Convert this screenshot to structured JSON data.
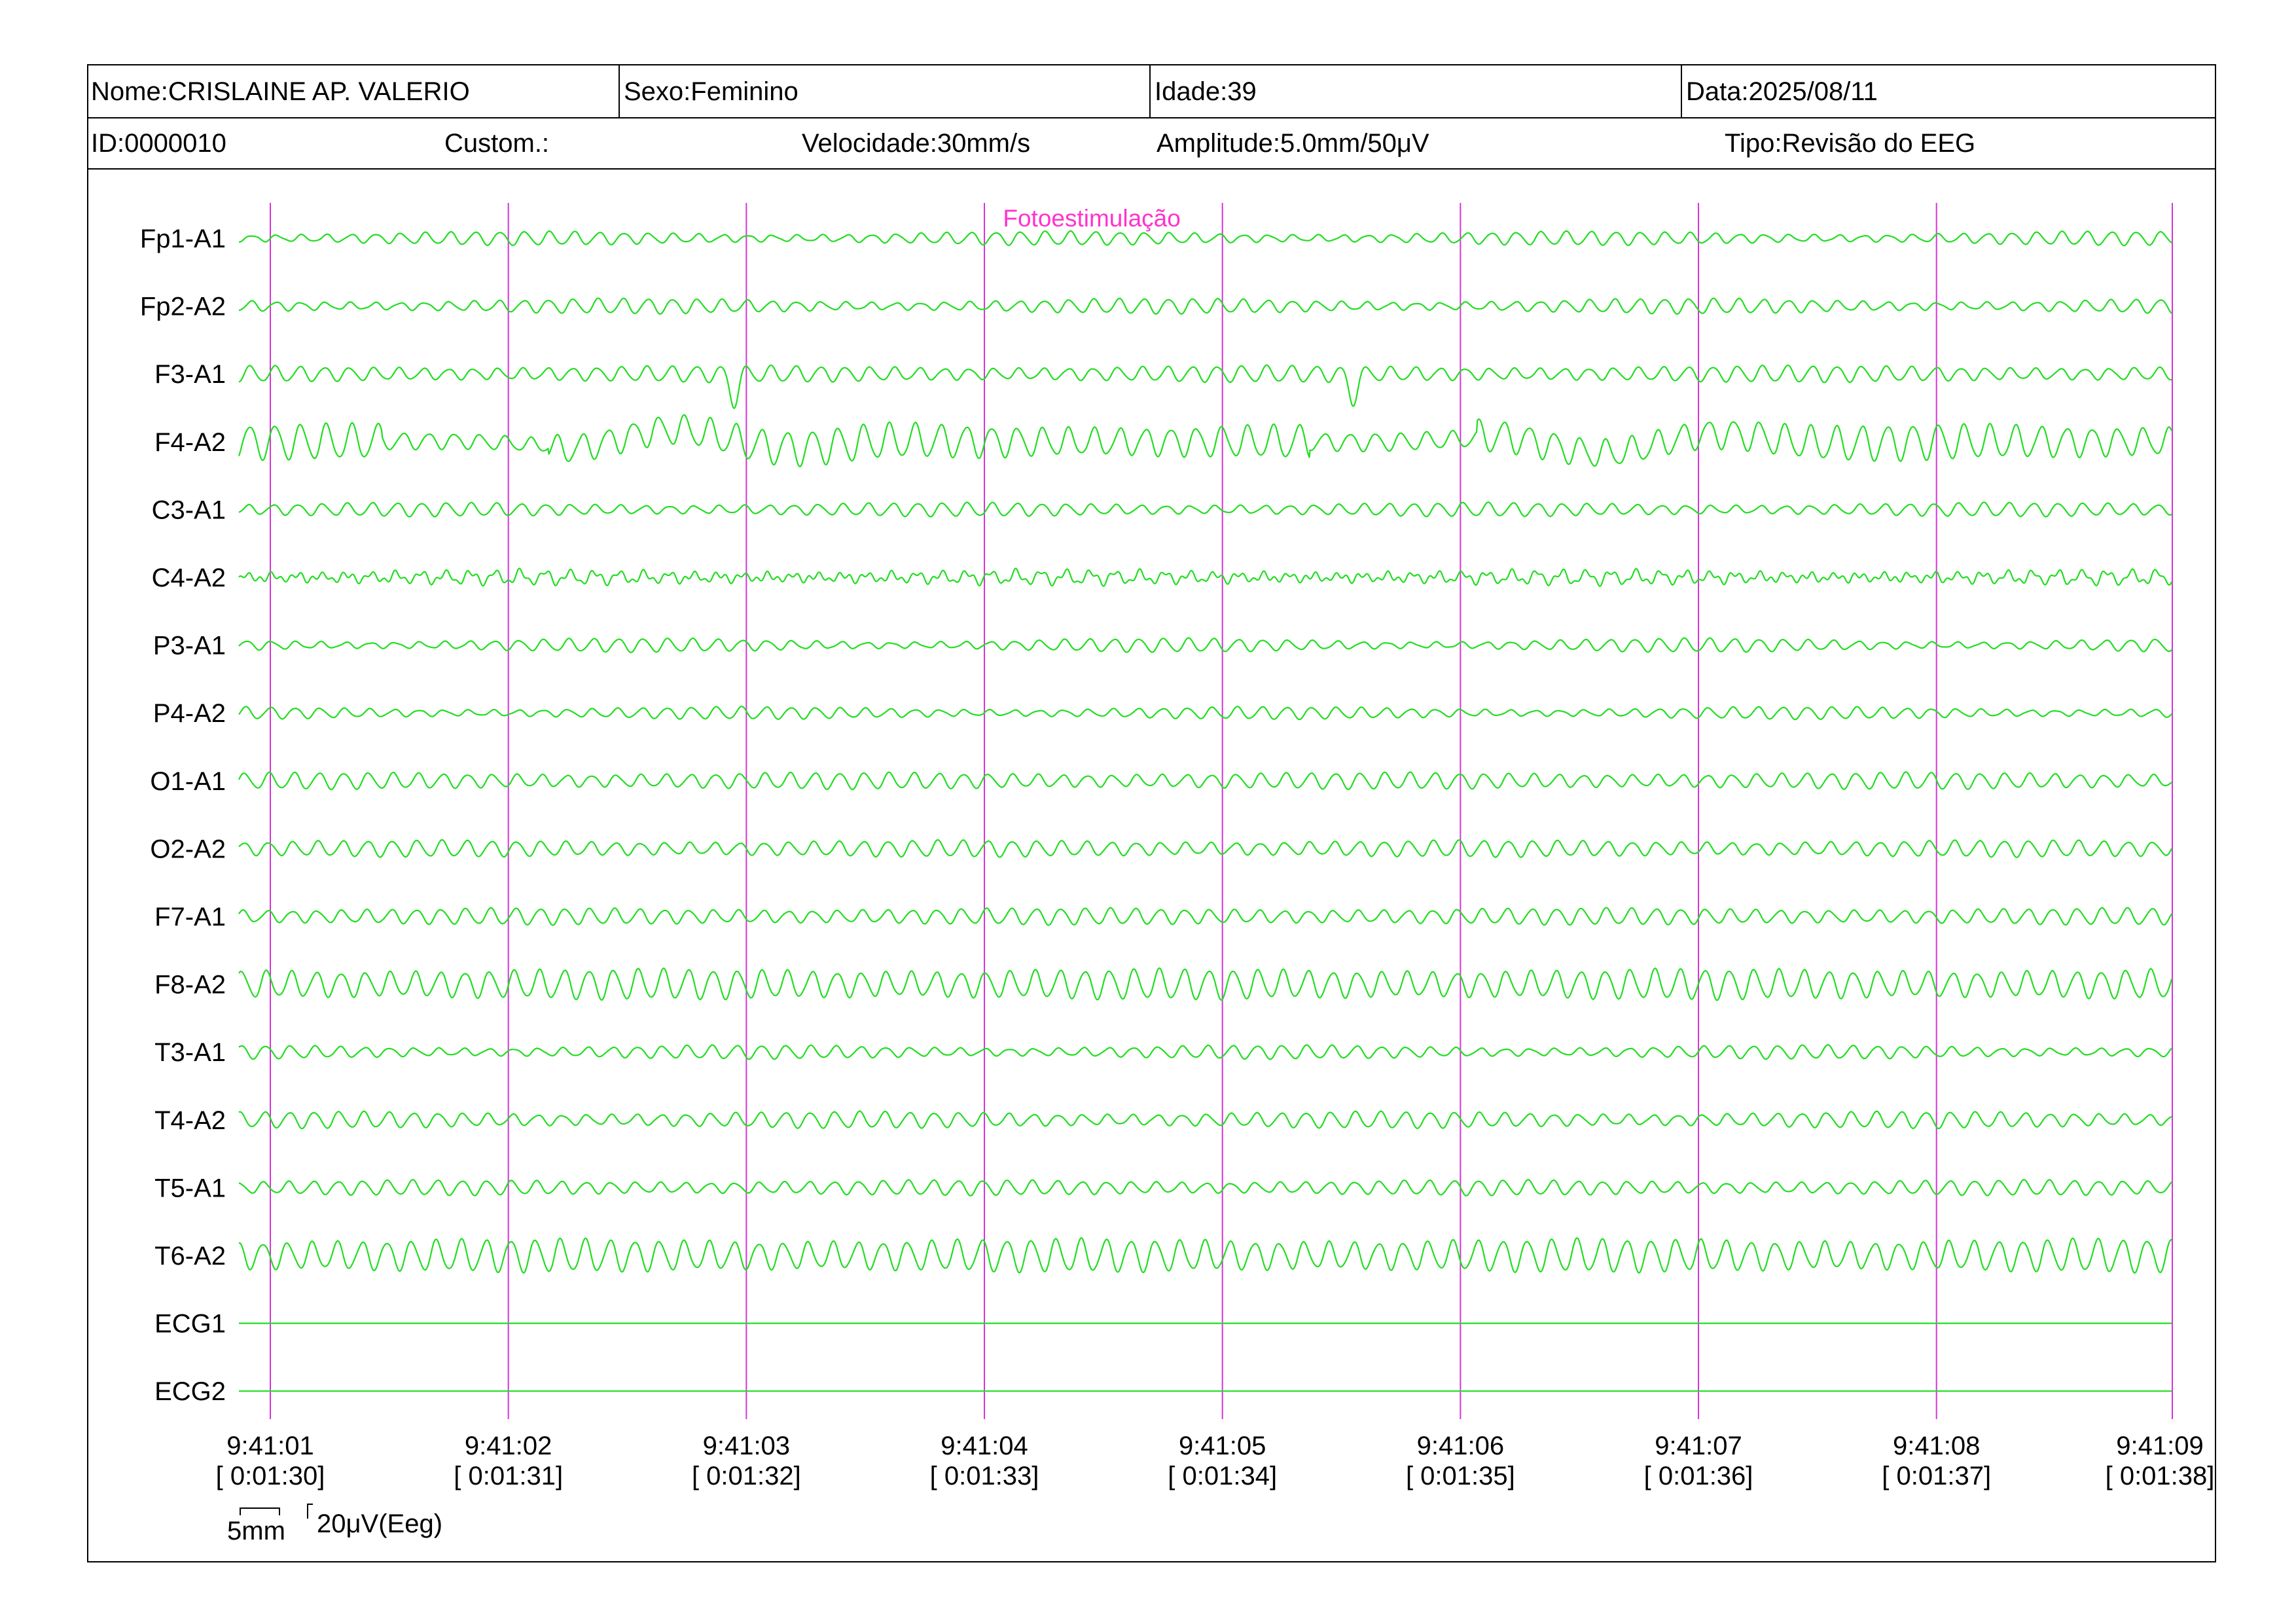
{
  "header": {
    "nome": "Nome:CRISLAINE AP. VALERIO",
    "sexo": "Sexo:Feminino",
    "idade": "Idade:39",
    "data": "Data:2025/08/11",
    "id": "ID:0000010",
    "custom": "Custom.:",
    "velocidade": "Velocidade:30mm/s",
    "amplitude": "Amplitude:5.0mm/50μV",
    "tipo": "Tipo:Revisão do EEG"
  },
  "annotation": {
    "label": "Fotoestimulação",
    "color": "#ff33cc"
  },
  "calibration": {
    "time_label": "5mm",
    "amp_label": "20μV(Eeg)"
  },
  "colors": {
    "trace": "#22dd22",
    "marker": "#d633d6",
    "text": "#000000",
    "annotation": "#ff33cc"
  },
  "chart_data": {
    "type": "line",
    "title": "",
    "x_ticks": [
      {
        "clock": "9:41:01",
        "elapsed": "[ 0:01:30]"
      },
      {
        "clock": "9:41:02",
        "elapsed": "[ 0:01:31]"
      },
      {
        "clock": "9:41:03",
        "elapsed": "[ 0:01:32]"
      },
      {
        "clock": "9:41:04",
        "elapsed": "[ 0:01:33]"
      },
      {
        "clock": "9:41:05",
        "elapsed": "[ 0:01:34]"
      },
      {
        "clock": "9:41:06",
        "elapsed": "[ 0:01:35]"
      },
      {
        "clock": "9:41:07",
        "elapsed": "[ 0:01:36]"
      },
      {
        "clock": "9:41:08",
        "elapsed": "[ 0:01:37]"
      },
      {
        "clock": "9:41:09",
        "elapsed": "[ 0:01:38]"
      }
    ],
    "duration_s": 8.12,
    "annotation_time_s": 3.1,
    "channels": [
      {
        "name": "Fp1-A1",
        "freq_hz": 9.6,
        "amp": 10,
        "mod_depth": 0.55,
        "artifact": "none"
      },
      {
        "name": "Fp2-A2",
        "freq_hz": 9.6,
        "amp": 11,
        "mod_depth": 0.55,
        "artifact": "none"
      },
      {
        "name": "F3-A1",
        "freq_hz": 9.6,
        "amp": 12,
        "mod_depth": 0.35,
        "artifact": "spikes"
      },
      {
        "name": "F4-A2",
        "freq_hz": 9.3,
        "amp": 26,
        "mod_depth": 0.25,
        "artifact": "slow"
      },
      {
        "name": "C3-A1",
        "freq_hz": 9.6,
        "amp": 10,
        "mod_depth": 0.45,
        "artifact": "none"
      },
      {
        "name": "C4-A2",
        "freq_hz": 9.6,
        "amp": 9,
        "mod_depth": 0.55,
        "artifact": "jitter"
      },
      {
        "name": "P3-A1",
        "freq_hz": 9.6,
        "amp": 10,
        "mod_depth": 0.6,
        "artifact": "none"
      },
      {
        "name": "P4-A2",
        "freq_hz": 9.6,
        "amp": 9,
        "mod_depth": 0.55,
        "artifact": "none"
      },
      {
        "name": "O1-A1",
        "freq_hz": 9.6,
        "amp": 12,
        "mod_depth": 0.3,
        "artifact": "none"
      },
      {
        "name": "O2-A2",
        "freq_hz": 9.6,
        "amp": 12,
        "mod_depth": 0.3,
        "artifact": "none"
      },
      {
        "name": "F7-A1",
        "freq_hz": 9.6,
        "amp": 12,
        "mod_depth": 0.3,
        "artifact": "none"
      },
      {
        "name": "F8-A2",
        "freq_hz": 9.6,
        "amp": 22,
        "mod_depth": 0.2,
        "artifact": "none"
      },
      {
        "name": "T3-A1",
        "freq_hz": 9.6,
        "amp": 10,
        "mod_depth": 0.5,
        "artifact": "none"
      },
      {
        "name": "T4-A2",
        "freq_hz": 9.6,
        "amp": 12,
        "mod_depth": 0.4,
        "artifact": "none"
      },
      {
        "name": "T5-A1",
        "freq_hz": 9.6,
        "amp": 11,
        "mod_depth": 0.35,
        "artifact": "none"
      },
      {
        "name": "T6-A2",
        "freq_hz": 9.6,
        "amp": 24,
        "mod_depth": 0.2,
        "artifact": "none"
      },
      {
        "name": "ECG1",
        "freq_hz": 0,
        "amp": 0,
        "mod_depth": 0,
        "artifact": "flat"
      },
      {
        "name": "ECG2",
        "freq_hz": 0,
        "amp": 0,
        "mod_depth": 0,
        "artifact": "flat"
      }
    ]
  }
}
